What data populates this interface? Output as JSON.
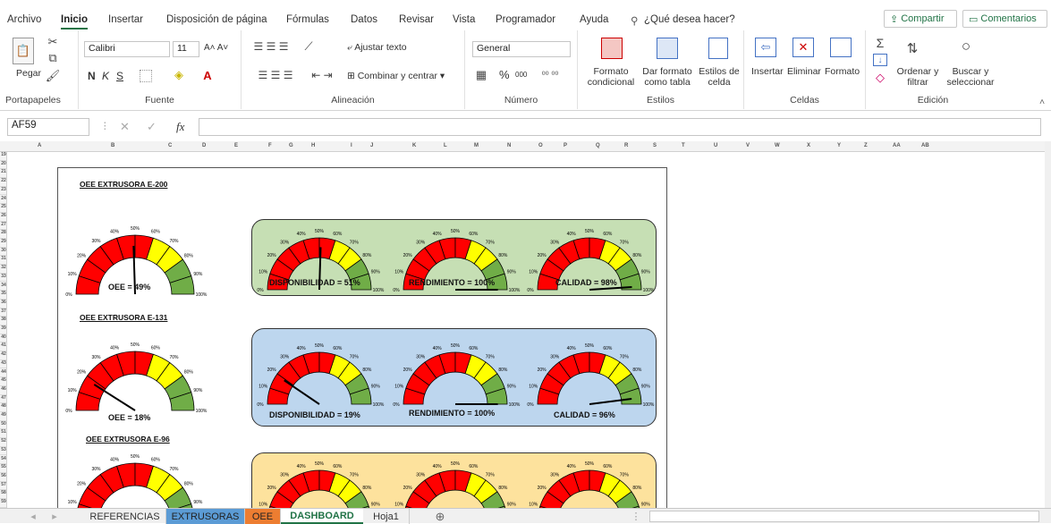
{
  "menu": {
    "tabs": [
      "Archivo",
      "Inicio",
      "Insertar",
      "Disposición de página",
      "Fórmulas",
      "Datos",
      "Revisar",
      "Vista",
      "Programador",
      "Ayuda"
    ],
    "search": "¿Qué desea hacer?",
    "share": "Compartir",
    "comments": "Comentarios"
  },
  "ribbon": {
    "clipboard": {
      "paste": "Pegar",
      "label": "Portapapeles"
    },
    "font": {
      "name": "Calibri",
      "size": "11",
      "bold": "N",
      "italic": "K",
      "underline": "S",
      "label": "Fuente"
    },
    "alignment": {
      "wrap": "Ajustar texto",
      "merge": "Combinar y centrar",
      "label": "Alineación"
    },
    "number": {
      "format": "General",
      "percent": "%",
      "thousands": "000",
      "label": "Número"
    },
    "styles": {
      "conditional": "Formato condicional",
      "astable": "Dar formato como tabla",
      "cellstyles": "Estilos de celda",
      "label": "Estilos"
    },
    "cells": {
      "insert": "Insertar",
      "delete": "Eliminar",
      "format": "Formato",
      "label": "Celdas"
    },
    "editing": {
      "sort": "Ordenar y filtrar",
      "find": "Buscar y seleccionar",
      "label": "Edición"
    }
  },
  "formula_bar": {
    "namebox": "AF59",
    "fx": "fx",
    "value": ""
  },
  "columns": [
    "A",
    "B",
    "C",
    "D",
    "E",
    "F",
    "G",
    "H",
    "I",
    "J",
    "K",
    "L",
    "M",
    "N",
    "O",
    "P",
    "Q",
    "R",
    "S",
    "T",
    "U",
    "V",
    "W",
    "X",
    "Y",
    "Z",
    "AA",
    "AB"
  ],
  "rows": [
    "19",
    "20",
    "21",
    "22",
    "23",
    "24",
    "25",
    "26",
    "27",
    "28",
    "29",
    "30",
    "31",
    "32",
    "33",
    "34",
    "35",
    "36",
    "37",
    "38",
    "39",
    "40",
    "41",
    "42",
    "43",
    "44",
    "45",
    "46",
    "47",
    "48",
    "49",
    "50",
    "51",
    "52",
    "53",
    "54",
    "55",
    "56",
    "57",
    "58",
    "59"
  ],
  "gauge_ticks": [
    "0%",
    "10%",
    "20%",
    "30%",
    "40%",
    "50%",
    "60%",
    "70%",
    "80%",
    "90%",
    "100%"
  ],
  "sections": [
    {
      "title": "OEE EXTRUSORA E-200",
      "oee_label": "OEE = 49%",
      "oee": 0.49,
      "panel_color": "#c6dfb4",
      "metrics": [
        {
          "label": "DISPONIBILIDAD = 51%",
          "value": 0.51
        },
        {
          "label": "RENDIMIENTO = 100%",
          "value": 1.0
        },
        {
          "label": "CALIDAD = 98%",
          "value": 0.98
        }
      ]
    },
    {
      "title": "OEE EXTRUSORA E-131",
      "oee_label": "OEE = 18%",
      "oee": 0.18,
      "panel_color": "#bdd6ee",
      "metrics": [
        {
          "label": "DISPONIBILIDAD = 19%",
          "value": 0.19
        },
        {
          "label": "RENDIMIENTO = 100%",
          "value": 1.0
        },
        {
          "label": "CALIDAD = 96%",
          "value": 0.96
        }
      ]
    },
    {
      "title": "OEE EXTRUSORA E-96",
      "oee_label": "",
      "oee": 0,
      "panel_color": "#fde29d",
      "metrics": [
        {
          "label": "",
          "value": 0
        },
        {
          "label": "",
          "value": 0
        },
        {
          "label": "",
          "value": 0
        }
      ]
    }
  ],
  "sheet_tabs": [
    {
      "label": "REFERENCIAS",
      "color": "#f0f0f0"
    },
    {
      "label": "EXTRUSORAS",
      "color": "#5b9bd5"
    },
    {
      "label": "OEE",
      "color": "#ed7d31"
    },
    {
      "label": "DASHBOARD",
      "color": "#ffffff"
    },
    {
      "label": "Hoja1",
      "color": "#f0f0f0"
    }
  ],
  "colors": {
    "accent": "#217346",
    "red": "#ff0000",
    "yellow": "#ffff00",
    "green": "#70ad47"
  }
}
